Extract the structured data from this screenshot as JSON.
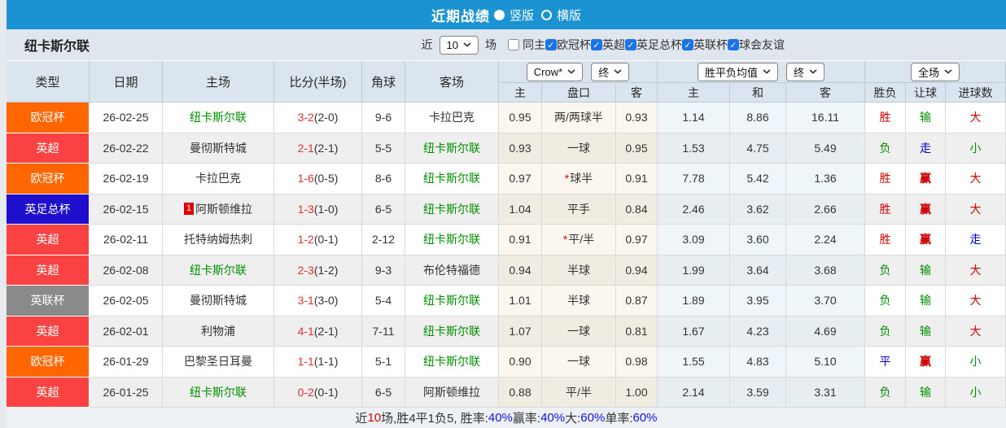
{
  "title_bar": {
    "title": "近期战绩",
    "radio_options": [
      {
        "label": "竖版",
        "selected": true
      },
      {
        "label": "横版",
        "selected": false
      }
    ]
  },
  "filter_bar": {
    "team_name": "纽卡斯尔联",
    "near_label": "近",
    "matches_count": "10",
    "matches_label": "场",
    "checkboxes": [
      {
        "label": "同主",
        "checked": false
      },
      {
        "label": "欧冠杯",
        "checked": true
      },
      {
        "label": "英超",
        "checked": true
      },
      {
        "label": "英足总杯",
        "checked": true
      },
      {
        "label": "英联杯",
        "checked": true
      },
      {
        "label": "球会友谊",
        "checked": true
      }
    ]
  },
  "table": {
    "main_headers": [
      "类型",
      "日期",
      "主场",
      "比分(半场)",
      "角球",
      "客场"
    ],
    "dropdowns": {
      "company": "Crow*",
      "company_time": "终",
      "avg": "胜平负均值",
      "avg_time": "终",
      "scope": "全场"
    },
    "sub_headers": [
      "主",
      "盘口",
      "客",
      "主",
      "和",
      "客",
      "胜负",
      "让球",
      "进球数"
    ],
    "league_colors": {
      "欧冠杯": "#ff6600",
      "英超": "#fb4242",
      "英足总杯": "#1f0ecc",
      "英联杯": "#8a8a8a"
    },
    "rows": [
      {
        "league": "欧冠杯",
        "date": "26-02-25",
        "home": {
          "name": "纽卡斯尔联",
          "green": true,
          "badge": ""
        },
        "score": {
          "full": "3-2",
          "half": "(2-0)"
        },
        "corner": "9-6",
        "away": {
          "name": "卡拉巴克",
          "green": false
        },
        "odds": {
          "home": "0.95",
          "star": false,
          "handicap": "两/两球半",
          "away": "0.93"
        },
        "avg": {
          "home": "1.14",
          "draw": "8.86",
          "away": "16.11"
        },
        "results": [
          {
            "text": "胜",
            "color": "red"
          },
          {
            "text": "输",
            "color": "green"
          },
          {
            "text": "大",
            "color": "red"
          }
        ]
      },
      {
        "league": "英超",
        "date": "26-02-22",
        "home": {
          "name": "曼彻斯特城",
          "green": false,
          "badge": ""
        },
        "score": {
          "full": "2-1",
          "half": "(2-1)"
        },
        "corner": "5-5",
        "away": {
          "name": "纽卡斯尔联",
          "green": true
        },
        "odds": {
          "home": "0.93",
          "star": false,
          "handicap": "一球",
          "away": "0.95"
        },
        "avg": {
          "home": "1.53",
          "draw": "4.75",
          "away": "5.49"
        },
        "results": [
          {
            "text": "负",
            "color": "green"
          },
          {
            "text": "走",
            "color": "blue"
          },
          {
            "text": "小",
            "color": "green"
          }
        ]
      },
      {
        "league": "欧冠杯",
        "date": "26-02-19",
        "home": {
          "name": "卡拉巴克",
          "green": false,
          "badge": ""
        },
        "score": {
          "full": "1-6",
          "half": "(0-5)"
        },
        "corner": "8-6",
        "away": {
          "name": "纽卡斯尔联",
          "green": true
        },
        "odds": {
          "home": "0.97",
          "star": true,
          "handicap": "球半",
          "away": "0.91"
        },
        "avg": {
          "home": "7.78",
          "draw": "5.42",
          "away": "1.36"
        },
        "results": [
          {
            "text": "胜",
            "color": "red"
          },
          {
            "text": "赢",
            "color": "red",
            "bold": true
          },
          {
            "text": "大",
            "color": "red"
          }
        ]
      },
      {
        "league": "英足总杯",
        "date": "26-02-15",
        "home": {
          "name": "阿斯顿维拉",
          "green": false,
          "badge": "1"
        },
        "score": {
          "full": "1-3",
          "half": "(1-0)"
        },
        "corner": "6-5",
        "away": {
          "name": "纽卡斯尔联",
          "green": true
        },
        "odds": {
          "home": "1.04",
          "star": false,
          "handicap": "平手",
          "away": "0.84"
        },
        "avg": {
          "home": "2.46",
          "draw": "3.62",
          "away": "2.66"
        },
        "results": [
          {
            "text": "胜",
            "color": "red"
          },
          {
            "text": "赢",
            "color": "red",
            "bold": true
          },
          {
            "text": "大",
            "color": "red"
          }
        ]
      },
      {
        "league": "英超",
        "date": "26-02-11",
        "home": {
          "name": "托特纳姆热刺",
          "green": false,
          "badge": ""
        },
        "score": {
          "full": "1-2",
          "half": "(0-1)"
        },
        "corner": "2-12",
        "away": {
          "name": "纽卡斯尔联",
          "green": true
        },
        "odds": {
          "home": "0.91",
          "star": true,
          "handicap": "平/半",
          "away": "0.97"
        },
        "avg": {
          "home": "3.09",
          "draw": "3.60",
          "away": "2.24"
        },
        "results": [
          {
            "text": "胜",
            "color": "red"
          },
          {
            "text": "赢",
            "color": "red",
            "bold": true
          },
          {
            "text": "走",
            "color": "blue"
          }
        ]
      },
      {
        "league": "英超",
        "date": "26-02-08",
        "home": {
          "name": "纽卡斯尔联",
          "green": true,
          "badge": ""
        },
        "score": {
          "full": "2-3",
          "half": "(1-2)"
        },
        "corner": "9-3",
        "away": {
          "name": "布伦特福德",
          "green": false
        },
        "odds": {
          "home": "0.94",
          "star": false,
          "handicap": "半球",
          "away": "0.94"
        },
        "avg": {
          "home": "1.99",
          "draw": "3.64",
          "away": "3.68"
        },
        "results": [
          {
            "text": "负",
            "color": "green"
          },
          {
            "text": "输",
            "color": "green"
          },
          {
            "text": "大",
            "color": "red"
          }
        ]
      },
      {
        "league": "英联杯",
        "date": "26-02-05",
        "home": {
          "name": "曼彻斯特城",
          "green": false,
          "badge": ""
        },
        "score": {
          "full": "3-1",
          "half": "(3-0)"
        },
        "corner": "5-4",
        "away": {
          "name": "纽卡斯尔联",
          "green": true
        },
        "odds": {
          "home": "1.01",
          "star": false,
          "handicap": "半球",
          "away": "0.87"
        },
        "avg": {
          "home": "1.89",
          "draw": "3.95",
          "away": "3.70"
        },
        "results": [
          {
            "text": "负",
            "color": "green"
          },
          {
            "text": "输",
            "color": "green"
          },
          {
            "text": "大",
            "color": "red"
          }
        ]
      },
      {
        "league": "英超",
        "date": "26-02-01",
        "home": {
          "name": "利物浦",
          "green": false,
          "badge": ""
        },
        "score": {
          "full": "4-1",
          "half": "(2-1)"
        },
        "corner": "7-11",
        "away": {
          "name": "纽卡斯尔联",
          "green": true
        },
        "odds": {
          "home": "1.07",
          "star": false,
          "handicap": "一球",
          "away": "0.81"
        },
        "avg": {
          "home": "1.67",
          "draw": "4.23",
          "away": "4.69"
        },
        "results": [
          {
            "text": "负",
            "color": "green"
          },
          {
            "text": "输",
            "color": "green"
          },
          {
            "text": "大",
            "color": "red"
          }
        ]
      },
      {
        "league": "欧冠杯",
        "date": "26-01-29",
        "home": {
          "name": "巴黎圣日耳曼",
          "green": false,
          "badge": ""
        },
        "score": {
          "full": "1-1",
          "half": "(1-1)"
        },
        "corner": "5-1",
        "away": {
          "name": "纽卡斯尔联",
          "green": true
        },
        "odds": {
          "home": "0.90",
          "star": false,
          "handicap": "一球",
          "away": "0.98"
        },
        "avg": {
          "home": "1.55",
          "draw": "4.83",
          "away": "5.10"
        },
        "results": [
          {
            "text": "平",
            "color": "blue"
          },
          {
            "text": "赢",
            "color": "red",
            "bold": true
          },
          {
            "text": "小",
            "color": "green"
          }
        ]
      },
      {
        "league": "英超",
        "date": "26-01-25",
        "home": {
          "name": "纽卡斯尔联",
          "green": true,
          "badge": ""
        },
        "score": {
          "full": "0-2",
          "half": "(0-1)"
        },
        "corner": "6-5",
        "away": {
          "name": "阿斯顿维拉",
          "green": false
        },
        "odds": {
          "home": "0.88",
          "star": false,
          "handicap": "平/半",
          "away": "1.00"
        },
        "avg": {
          "home": "2.14",
          "draw": "3.59",
          "away": "3.31"
        },
        "results": [
          {
            "text": "负",
            "color": "green"
          },
          {
            "text": "输",
            "color": "green"
          },
          {
            "text": "小",
            "color": "green"
          }
        ]
      }
    ]
  },
  "footer": {
    "parts": [
      {
        "text": "近",
        "color": "dark"
      },
      {
        "text": "10",
        "color": "red"
      },
      {
        "text": "场,胜4平1负5, 胜率:",
        "color": "dark"
      },
      {
        "text": "40%",
        "color": "blue"
      },
      {
        "text": " 赢率:",
        "color": "dark"
      },
      {
        "text": "40%",
        "color": "blue"
      },
      {
        "text": " 大:",
        "color": "dark"
      },
      {
        "text": "60%",
        "color": "blue"
      },
      {
        "text": " 单率:",
        "color": "dark"
      },
      {
        "text": "60%",
        "color": "blue"
      }
    ]
  }
}
